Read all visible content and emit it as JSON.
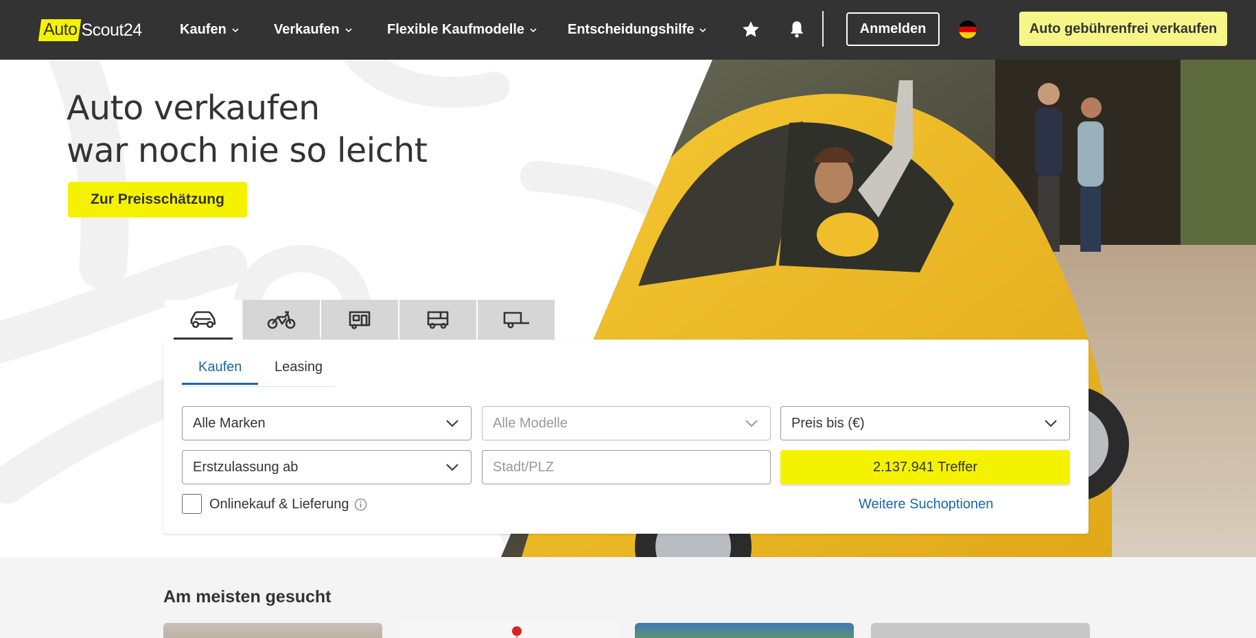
{
  "header": {
    "logo_auto": "Auto",
    "logo_scout": "Scout24",
    "nav": [
      {
        "label": "Kaufen"
      },
      {
        "label": "Verkaufen"
      },
      {
        "label": "Flexible Kaufmodelle"
      },
      {
        "label": "Entscheidungshilfe"
      }
    ],
    "login_label": "Anmelden",
    "sell_label": "Auto gebührenfrei verkaufen",
    "icons": [
      "star-icon",
      "bell-icon",
      "germany-flag-icon"
    ]
  },
  "hero": {
    "title_line1": "Auto verkaufen",
    "title_line2": "war noch nie so leicht",
    "cta_label": "Zur Preisschätzung"
  },
  "search": {
    "vehicle_tabs": [
      "car-icon",
      "motorbike-icon",
      "caravan-icon",
      "truck-icon",
      "trailer-icon"
    ],
    "tabs": [
      {
        "label": "Kaufen"
      },
      {
        "label": "Leasing"
      }
    ],
    "fields": {
      "make": "Alle Marken",
      "model": "Alle Modelle",
      "price": "Preis bis (€)",
      "first_registration": "Erstzulassung ab",
      "location_placeholder": "Stadt/PLZ"
    },
    "results_label": "2.137.941 Treffer",
    "online_checkbox_label": "Onlinekauf & Lieferung",
    "more_options_label": "Weitere Suchoptionen"
  },
  "most_searched": {
    "title": "Am meisten gesucht"
  },
  "colors": {
    "header_bg": "#333333",
    "brand_yellow": "#f5f200",
    "sell_button": "#f6f588",
    "link_blue": "#1a66a8"
  }
}
